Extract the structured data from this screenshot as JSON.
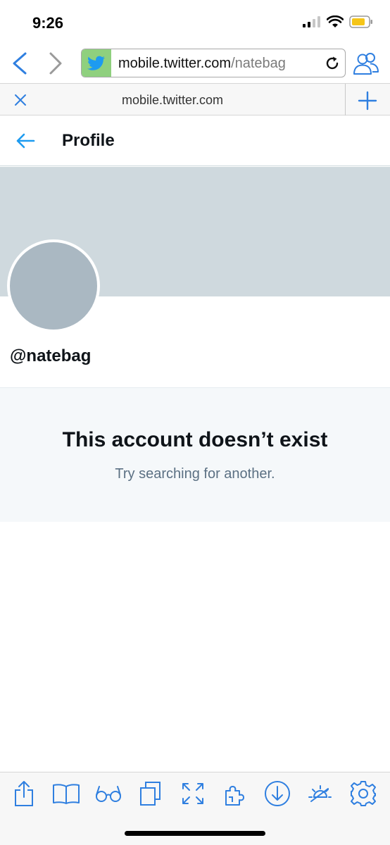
{
  "status_bar": {
    "time": "9:26",
    "icons": [
      "signal-icon",
      "wifi-icon",
      "battery-icon"
    ],
    "battery_color": "#f5c518"
  },
  "browser": {
    "url_host": "mobile.twitter.com",
    "url_path": "/natebag",
    "tab_title": "mobile.twitter.com",
    "accent": "#2f7fe0",
    "favicon": "twitter-bird-icon"
  },
  "header": {
    "title": "Profile"
  },
  "profile": {
    "handle": "@natebag"
  },
  "empty_state": {
    "title": "This account doesn’t exist",
    "subtitle": "Try searching for another."
  },
  "toolbar": {
    "items": [
      "share-icon",
      "bookmarks-icon",
      "reader-glasses-icon",
      "tabs-copy-icon",
      "fullscreen-icon",
      "extensions-puzzle-icon",
      "download-icon",
      "night-mode-icon",
      "settings-gear-icon"
    ]
  },
  "colors": {
    "banner": "#cfd9de",
    "avatar": "#aab8c2",
    "empty_bg": "#f5f8fa",
    "link_blue": "#1d9bf0"
  }
}
